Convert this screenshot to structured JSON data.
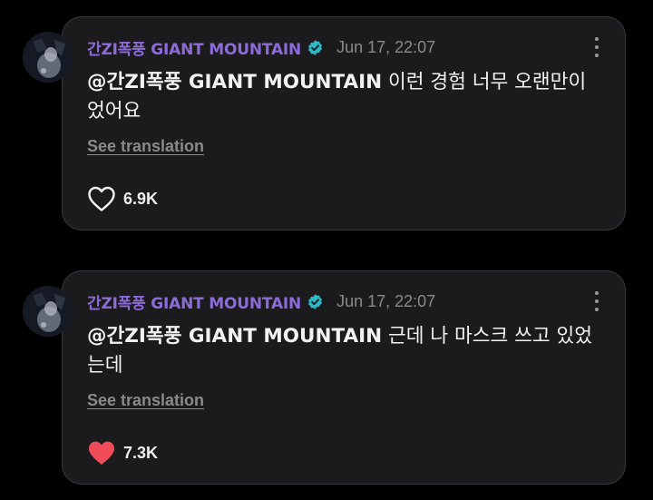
{
  "colors": {
    "author": "#8d6bd9",
    "verified_badge": "#2fb8c6",
    "liked_heart": "#f04b58",
    "card_bg": "#1b1b1d",
    "card_border": "#3a3a3e"
  },
  "posts": [
    {
      "author": "간ZI폭풍 GIANT MOUNTAIN",
      "verified_icon": "verified-badge-icon",
      "timestamp": "Jun 17, 22:07",
      "mention": "@간ZI폭풍 GIANT MOUNTAIN",
      "message": " 이런 경험 너무 오랜만이었어요",
      "translate_label": "See translation",
      "like_count": "6.9K",
      "liked": false,
      "heart_icon": "heart-outline-icon",
      "more_icon": "more-vertical-icon"
    },
    {
      "author": "간ZI폭풍 GIANT MOUNTAIN",
      "verified_icon": "verified-badge-icon",
      "timestamp": "Jun 17, 22:07",
      "mention": "@간ZI폭풍 GIANT MOUNTAIN",
      "message": " 근데 나 마스크 쓰고 있었는데",
      "translate_label": "See translation",
      "like_count": "7.3K",
      "liked": true,
      "heart_icon": "heart-filled-icon",
      "more_icon": "more-vertical-icon"
    }
  ]
}
